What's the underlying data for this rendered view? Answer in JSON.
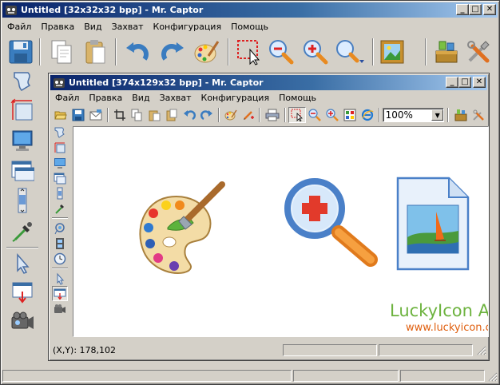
{
  "outer": {
    "title": "Untitled [32x32x32 bpp] - Mr. Captor",
    "menu": [
      "Файл",
      "Правка",
      "Вид",
      "Захват",
      "Конфигурация",
      "Помощь"
    ]
  },
  "inner": {
    "title": "Untitled [374x129x32 bpp] - Mr. Captor",
    "menu": [
      "Файл",
      "Правка",
      "Вид",
      "Захват",
      "Конфигурация",
      "Помощь"
    ],
    "zoom": {
      "value": "100%"
    },
    "status": {
      "coords": "(X,Y): 178,102"
    }
  },
  "window_buttons": {
    "minimize": "_",
    "maximize": "□",
    "close": "✕"
  },
  "combo_arrow": "▼",
  "canvas": {
    "watermark_title": "LuckyIcon Art",
    "watermark_url": "www.luckyicon.com"
  },
  "colors": {
    "title_start": "#0a246a",
    "title_end": "#a6caf0",
    "face": "#d4d0c8",
    "watermark": "#6db33f",
    "url": "#e06010"
  }
}
